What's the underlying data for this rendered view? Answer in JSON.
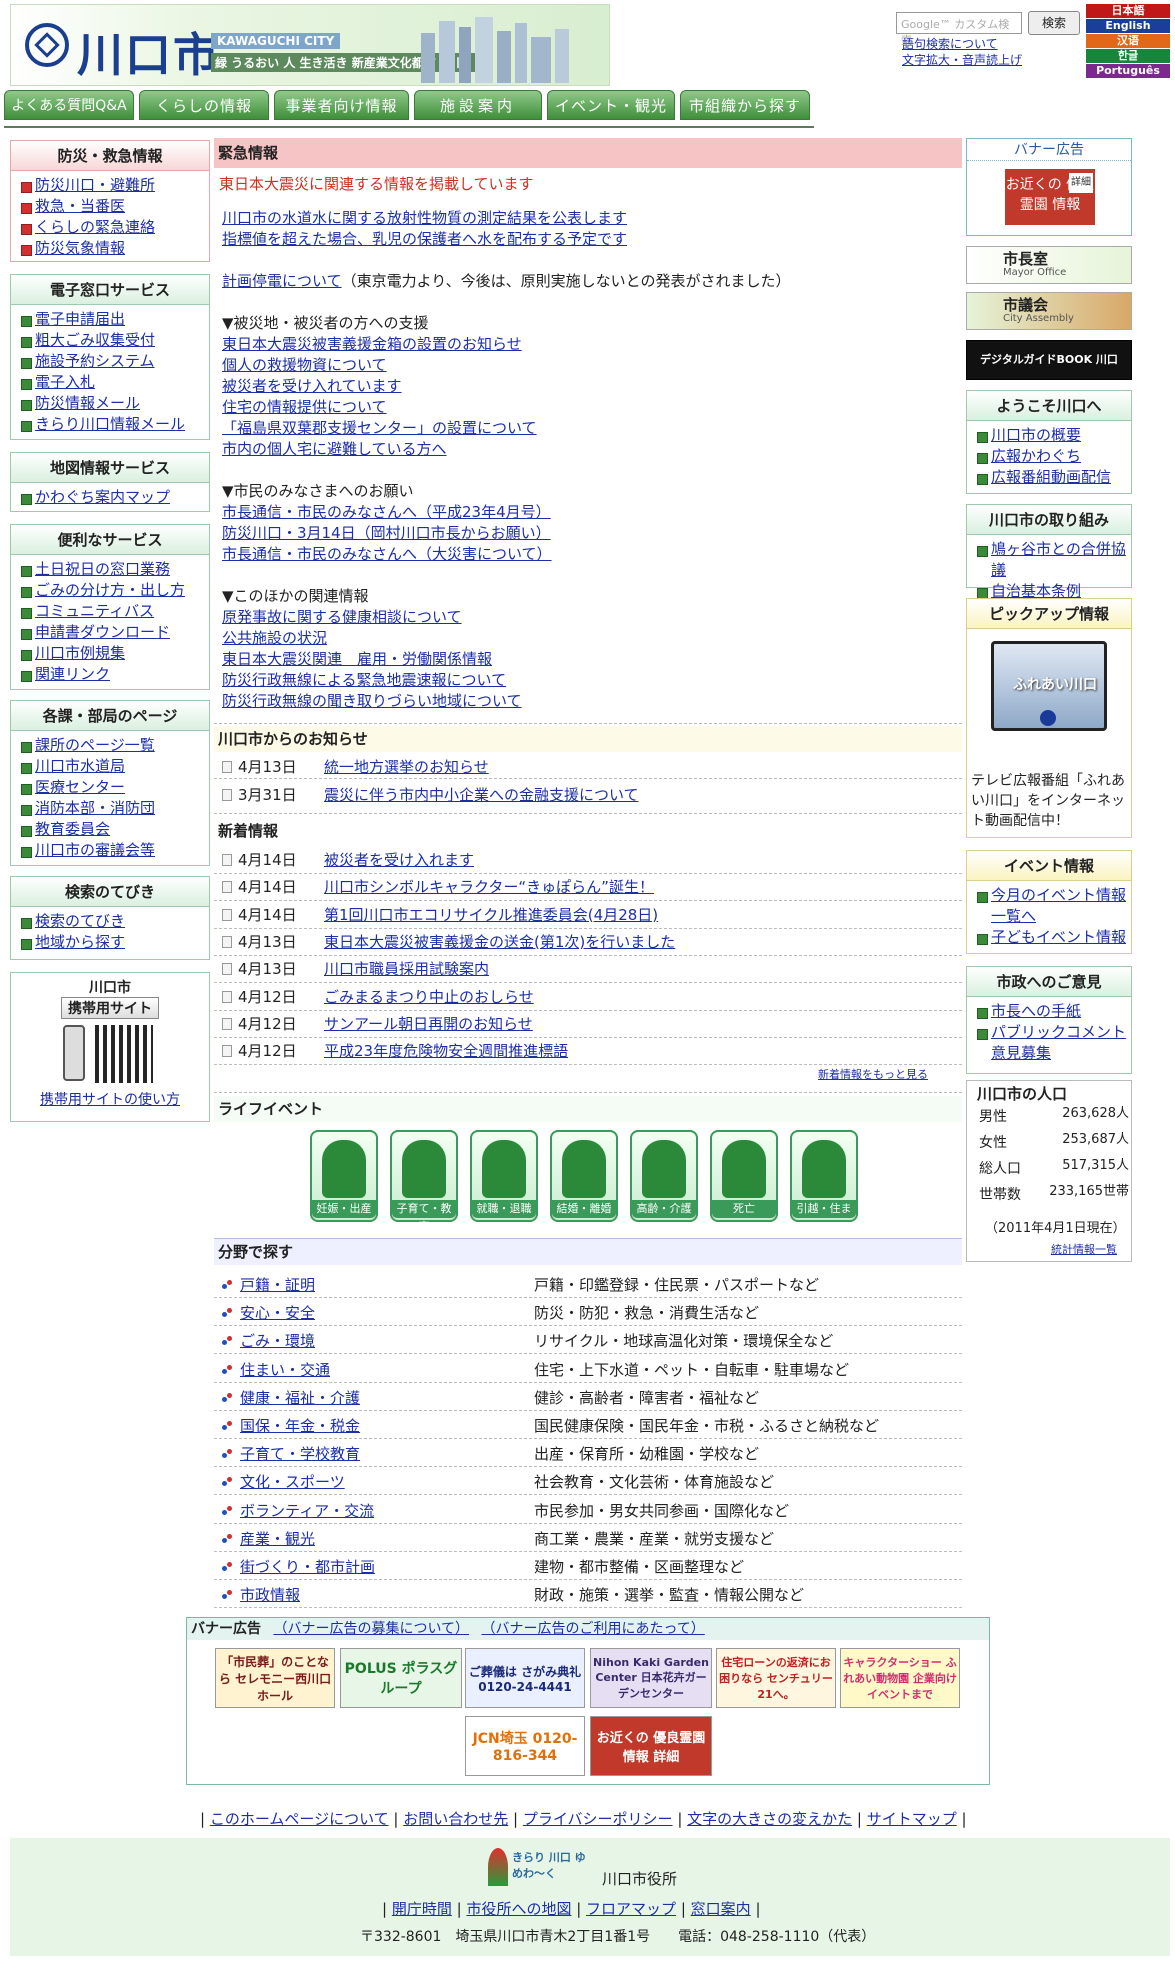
{
  "header": {
    "city_name": "川口市",
    "city_sub": "KAWAGUCHI CITY",
    "slogan": "緑 うるおい 人 生き活き 新産業文化都市・川口",
    "search_placeholder": "Google™ カスタム検索",
    "search_button": "検索",
    "links": [
      "語句検索について",
      "文字拡大・音声読上げ"
    ],
    "languages": [
      "日本語",
      "English",
      "汉语",
      "한글",
      "Português"
    ]
  },
  "nav": [
    "よくある質問Q&A",
    "くらしの情報",
    "事業者向け情報",
    "施設案内",
    "イベント・観光",
    "市組織から探す"
  ],
  "left": {
    "disaster": {
      "title": "防災・救急情報",
      "items": [
        "防災川口・避難所",
        "救急・当番医",
        "くらしの緊急連絡",
        "防災気象情報"
      ]
    },
    "e_services": {
      "title": "電子窓口サービス",
      "items": [
        "電子申請届出",
        "粗大ごみ収集受付",
        "施設予約システム",
        "電子入札",
        "防災情報メール",
        "きらり川口情報メール"
      ]
    },
    "map": {
      "title": "地図情報サービス",
      "items": [
        "かわぐち案内マップ"
      ]
    },
    "useful": {
      "title": "便利なサービス",
      "items": [
        "土日祝日の窓口業務",
        "ごみの分け方・出し方",
        "コミュニティバス",
        "申請書ダウンロード",
        "川口市例規集",
        "関連リンク"
      ]
    },
    "departments": {
      "title": "各課・部局のページ",
      "items": [
        "課所のページ一覧",
        "川口市水道局",
        "医療センター",
        "消防本部・消防団",
        "教育委員会",
        "川口市の審議会等"
      ]
    },
    "search_guide": {
      "title": "検索のてびき",
      "items": [
        "検索のてびき",
        "地域から探す"
      ]
    },
    "mobile": {
      "title_line1": "川口市",
      "title_line2": "携帯用サイト",
      "link": "携帯用サイトの使い方"
    }
  },
  "emergency": {
    "title": "緊急情報",
    "headline": "東日本大震災に関連する情報を掲載しています",
    "lines": [
      {
        "text": "川口市の水道水に関する放射性物質の測定結果を公表します",
        "link": true
      },
      {
        "text": "指標値を超えた場合、乳児の保護者へ水を配布する予定です",
        "link": true
      },
      {
        "text": "",
        "link": false
      },
      {
        "text": "計画停電について",
        "link": true,
        "suffix": "（東京電力より、今後は、原則実施しないとの発表がされました）"
      },
      {
        "text": "",
        "link": false
      },
      {
        "text": "▼被災地・被災者の方への支援",
        "link": false
      },
      {
        "text": "東日本大震災被害義援金箱の設置のお知らせ",
        "link": true
      },
      {
        "text": "個人の救援物資について",
        "link": true
      },
      {
        "text": "被災者を受け入れています",
        "link": true
      },
      {
        "text": "住宅の情報提供について",
        "link": true
      },
      {
        "text": "「福島県双葉郡支援センター」の設置について",
        "link": true
      },
      {
        "text": "市内の個人宅に避難している方へ",
        "link": true
      },
      {
        "text": "",
        "link": false
      },
      {
        "text": "▼市民のみなさまへのお願い",
        "link": false
      },
      {
        "text": "市長通信・市民のみなさんへ（平成23年4月号）",
        "link": true
      },
      {
        "text": "防災川口・3月14日（岡村川口市長からお願い）",
        "link": true
      },
      {
        "text": "市長通信・市民のみなさんへ（大災害について）",
        "link": true
      },
      {
        "text": "",
        "link": false
      },
      {
        "text": "▼このほかの関連情報",
        "link": false
      },
      {
        "text": "原発事故に関する健康相談について",
        "link": true
      },
      {
        "text": "公共施設の状況",
        "link": true
      },
      {
        "text": "東日本大震災関連　雇用・労働関係情報",
        "link": true
      },
      {
        "text": "防災行政無線による緊急地震速報について",
        "link": true
      },
      {
        "text": "防災行政無線の聞き取りづらい地域について",
        "link": true
      }
    ]
  },
  "notices": {
    "title": "川口市からのお知らせ",
    "items": [
      {
        "date": "4月13日",
        "text": "統一地方選挙のお知らせ"
      },
      {
        "date": "3月31日",
        "text": "震災に伴う市内中小企業への金融支援について"
      }
    ]
  },
  "news": {
    "title": "新着情報",
    "items": [
      {
        "date": "4月14日",
        "text": "被災者を受け入れます"
      },
      {
        "date": "4月14日",
        "text": "川口市シンボルキャラクター“きゅぽらん”誕生！"
      },
      {
        "date": "4月14日",
        "text": "第1回川口市エコリサイクル推進委員会(4月28日)"
      },
      {
        "date": "4月13日",
        "text": "東日本大震災被害義援金の送金(第1次)を行いました"
      },
      {
        "date": "4月13日",
        "text": "川口市職員採用試験案内"
      },
      {
        "date": "4月12日",
        "text": "ごみまるまつり中止のおしらせ"
      },
      {
        "date": "4月12日",
        "text": "サンアール朝日再開のお知らせ"
      },
      {
        "date": "4月12日",
        "text": "平成23年度危険物安全週間推進標語"
      }
    ],
    "more": "新着情報をもっと見る"
  },
  "life_events": {
    "title": "ライフイベント",
    "items": [
      "妊娠・出産",
      "子育て・教育",
      "就職・退職",
      "結婚・離婚",
      "高齢・介護",
      "死亡",
      "引越・住まい"
    ]
  },
  "fields": {
    "title": "分野で探す",
    "items": [
      {
        "name": "戸籍・証明",
        "desc": "戸籍・印鑑登録・住民票・パスポートなど"
      },
      {
        "name": "安心・安全",
        "desc": "防災・防犯・救急・消費生活など"
      },
      {
        "name": "ごみ・環境",
        "desc": "リサイクル・地球高温化対策・環境保全など"
      },
      {
        "name": "住まい・交通",
        "desc": "住宅・上下水道・ペット・自転車・駐車場など"
      },
      {
        "name": "健康・福祉・介護",
        "desc": "健診・高齢者・障害者・福祉など"
      },
      {
        "name": "国保・年金・税金",
        "desc": "国民健康保険・国民年金・市税・ふるさと納税など"
      },
      {
        "name": "子育て・学校教育",
        "desc": "出産・保育所・幼稚園・学校など"
      },
      {
        "name": "文化・スポーツ",
        "desc": "社会教育・文化芸術・体育施設など"
      },
      {
        "name": "ボランティア・交流",
        "desc": "市民参加・男女共同参画・国際化など"
      },
      {
        "name": "産業・観光",
        "desc": "商工業・農業・産業・就労支援など"
      },
      {
        "name": "街づくり・都市計画",
        "desc": "建物・都市整備・区画整理など"
      },
      {
        "name": "市政情報",
        "desc": "財政・施策・選挙・監査・情報公開など"
      }
    ]
  },
  "banner_ads": {
    "title": "バナー広告",
    "links": [
      "（バナー広告の募集について）",
      "（バナー広告のご利用にあたって）"
    ],
    "items": [
      "「市民葬」のことなら セレモニー西川口ホール",
      "POLUS ポラスグループ",
      "ご葬儀は さがみ典礼 0120-24-4441",
      "Nihon Kaki Garden Center 日本花卉ガーデンセンター",
      "住宅ローンの返済にお困りなら センチュリー21へ。",
      "キャラクターショー ふれあい動物園 企業向けイベントまで",
      "JCN埼玉 0120-816-344",
      "お近くの 優良霊園 情報 詳細"
    ]
  },
  "right": {
    "banner_title": "バナー広告",
    "banner_text": "お近くの 優良霊園 情報",
    "banner_detail": "詳細",
    "mayor": "市長室",
    "mayor_en": "Mayor Office",
    "assembly": "市議会",
    "assembly_en": "City Assembly",
    "guidebook": "デジタルガイドBOOK 川口 city.com",
    "welcome": {
      "title": "ようこそ川口へ",
      "items": [
        "川口市の概要",
        "広報かわぐち",
        "広報番組動画配信"
      ]
    },
    "efforts": {
      "title": "川口市の取り組み",
      "items": [
        "鳩ヶ谷市との合併協議",
        "自治基本条例"
      ]
    },
    "pickup": {
      "title": "ピックアップ情報",
      "video_text": "ふれあい川口",
      "caption": "テレビ広報番組「ふれあい川口」をインターネット動画配信中！"
    },
    "events": {
      "title": "イベント情報",
      "items": [
        "今月のイベント情報一覧へ",
        "子どもイベント情報"
      ]
    },
    "opinion": {
      "title": "市政へのご意見",
      "items": [
        "市長への手紙",
        "パブリックコメント意見募集"
      ]
    },
    "population": {
      "title": "川口市の人口",
      "rows": [
        {
          "label": "男性",
          "value": "263,628人"
        },
        {
          "label": "女性",
          "value": "253,687人"
        },
        {
          "label": "総人口",
          "value": "517,315人"
        },
        {
          "label": "世帯数",
          "value": "233,165世帯"
        }
      ],
      "date": "（2011年4月1日現在）",
      "link": "統計情報一覧"
    }
  },
  "footer": {
    "links": [
      "このホームページについて",
      "お問い合わせ先",
      "プライバシーポリシー",
      "文字の大きさの変えかた",
      "サイトマップ"
    ],
    "logo_text": "きらり 川口 ゆめわ～く",
    "office": "川口市役所",
    "links2": [
      "開庁時間",
      "市役所への地図",
      "フロアマップ",
      "窓口案内"
    ],
    "address": "〒332-8601　埼玉県川口市青木2丁目1番1号　　電話：048-258-1110（代表）"
  }
}
